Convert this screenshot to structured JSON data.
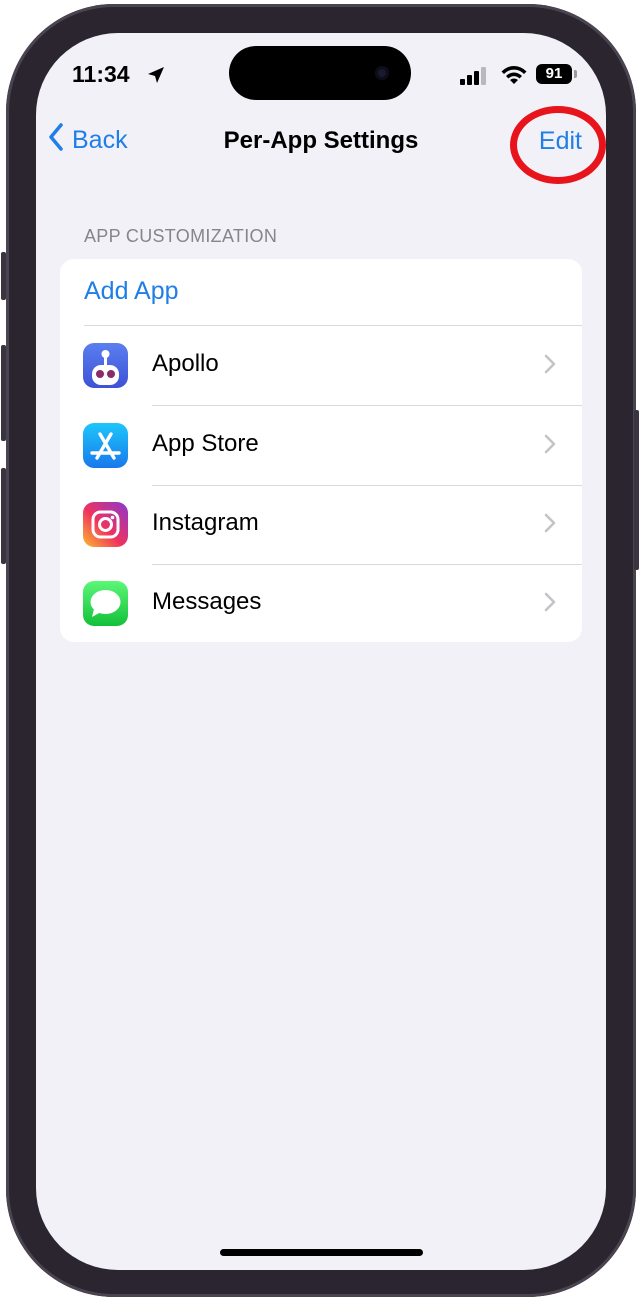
{
  "status_bar": {
    "time": "11:34",
    "battery": "91"
  },
  "nav": {
    "back_label": "Back",
    "title": "Per-App Settings",
    "edit_label": "Edit"
  },
  "section": {
    "header": "APP CUSTOMIZATION"
  },
  "list": {
    "add_app_label": "Add App",
    "apps": [
      {
        "label": "Apollo",
        "icon": "apollo-icon"
      },
      {
        "label": "App Store",
        "icon": "app-store-icon"
      },
      {
        "label": "Instagram",
        "icon": "instagram-icon"
      },
      {
        "label": "Messages",
        "icon": "messages-icon"
      }
    ]
  },
  "colors": {
    "accent": "#1f7ee8",
    "highlight_circle": "#e8141c",
    "background": "#f2f1f7"
  }
}
